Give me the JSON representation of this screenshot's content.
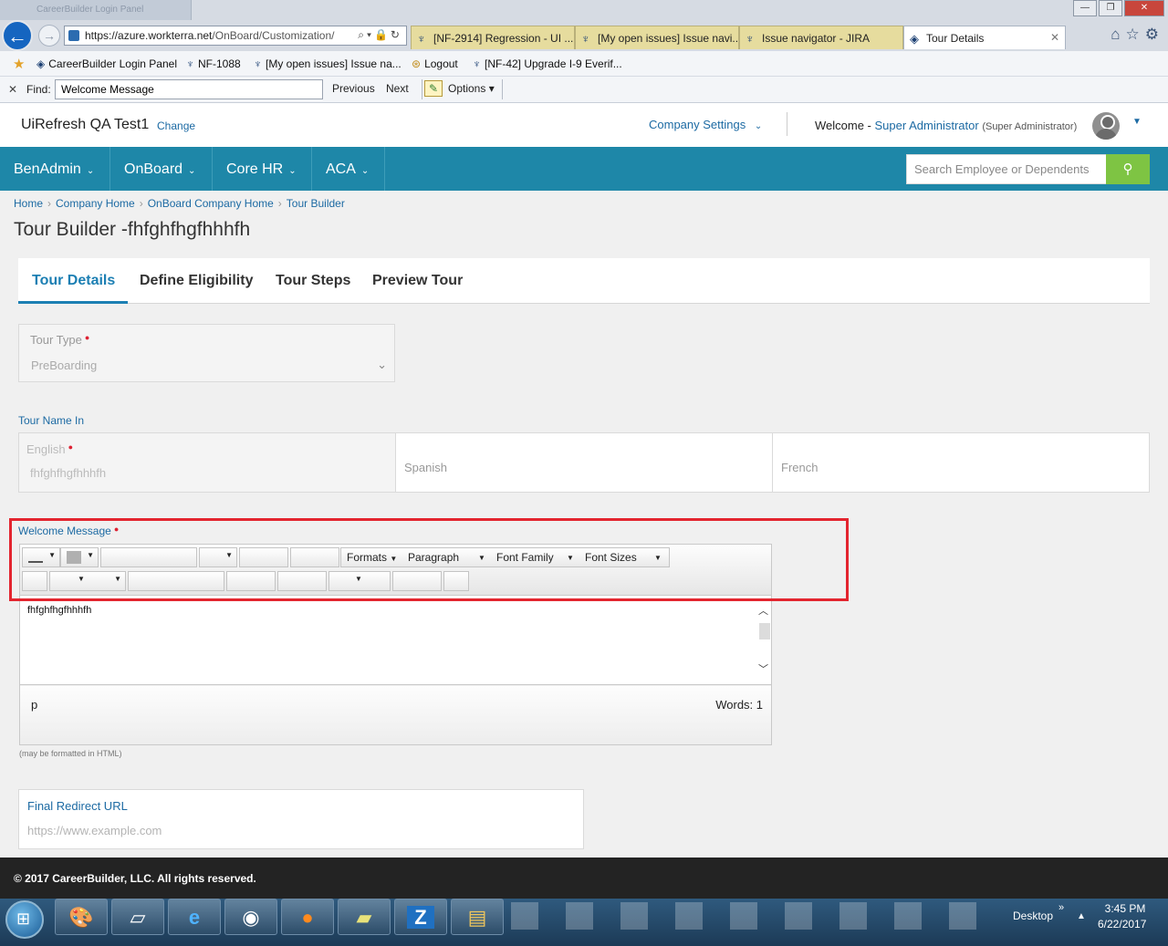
{
  "browser": {
    "address_domain": "https://azure.workterra.net",
    "address_path": "/OnBoard/Customization/",
    "tabs": [
      {
        "label": "[NF-2914] Regression - UI ...",
        "icon": "jira-icon"
      },
      {
        "label": "[My open issues] Issue navi...",
        "icon": "jira-icon"
      },
      {
        "label": "Issue navigator - JIRA",
        "icon": "jira-icon"
      },
      {
        "label": "Tour Details",
        "icon": "page-icon"
      }
    ],
    "favorites": [
      "CareerBuilder Login Panel",
      "NF-1088",
      "[My open issues] Issue na...",
      "Logout",
      "[NF-42] Upgrade I-9 Everif..."
    ],
    "find": {
      "label": "Find:",
      "value": "Welcome Message",
      "previous": "Previous",
      "next": "Next",
      "options": "Options"
    }
  },
  "header": {
    "company_name": "UiRefresh QA Test1",
    "change_label": "Change",
    "company_settings": "Company Settings",
    "welcome_prefix": "Welcome -",
    "user_name": "Super Administrator",
    "user_role": "(Super Administrator)"
  },
  "nav": {
    "items": [
      "BenAdmin",
      "OnBoard",
      "Core HR",
      "ACA"
    ],
    "search_placeholder": "Search Employee or Dependents"
  },
  "breadcrumb": [
    "Home",
    "Company Home",
    "OnBoard Company Home",
    "Tour Builder"
  ],
  "page_title": "Tour Builder -fhfghfhgfhhhfh",
  "page_tabs": [
    "Tour Details",
    "Define Eligibility",
    "Tour Steps",
    "Preview Tour"
  ],
  "form": {
    "tour_type_label": "Tour Type",
    "tour_type_value": "PreBoarding",
    "tour_name_section": "Tour Name In",
    "english_label": "English",
    "english_value": "fhfghfhgfhhhfh",
    "spanish_label": "Spanish",
    "french_label": "French",
    "welcome_label": "Welcome Message",
    "editor": {
      "formats": "Formats",
      "paragraph": "Paragraph",
      "font_family": "Font Family",
      "font_sizes": "Font Sizes",
      "content": "fhfghfhgfhhhfh",
      "path": "p",
      "words": "Words: 1"
    },
    "editor_note": "(may be formatted in HTML)",
    "redirect_label": "Final Redirect URL",
    "redirect_placeholder": "https://www.example.com"
  },
  "footer": "© 2017 CareerBuilder, LLC. All rights reserved.",
  "taskbar": {
    "desktop_label": "Desktop",
    "time": "3:45 PM",
    "date": "6/22/2017"
  },
  "colors": {
    "nav_bg": "#1e87a8",
    "accent": "#1c7fb3",
    "search_button": "#7ec443",
    "highlight": "#e3252f"
  }
}
